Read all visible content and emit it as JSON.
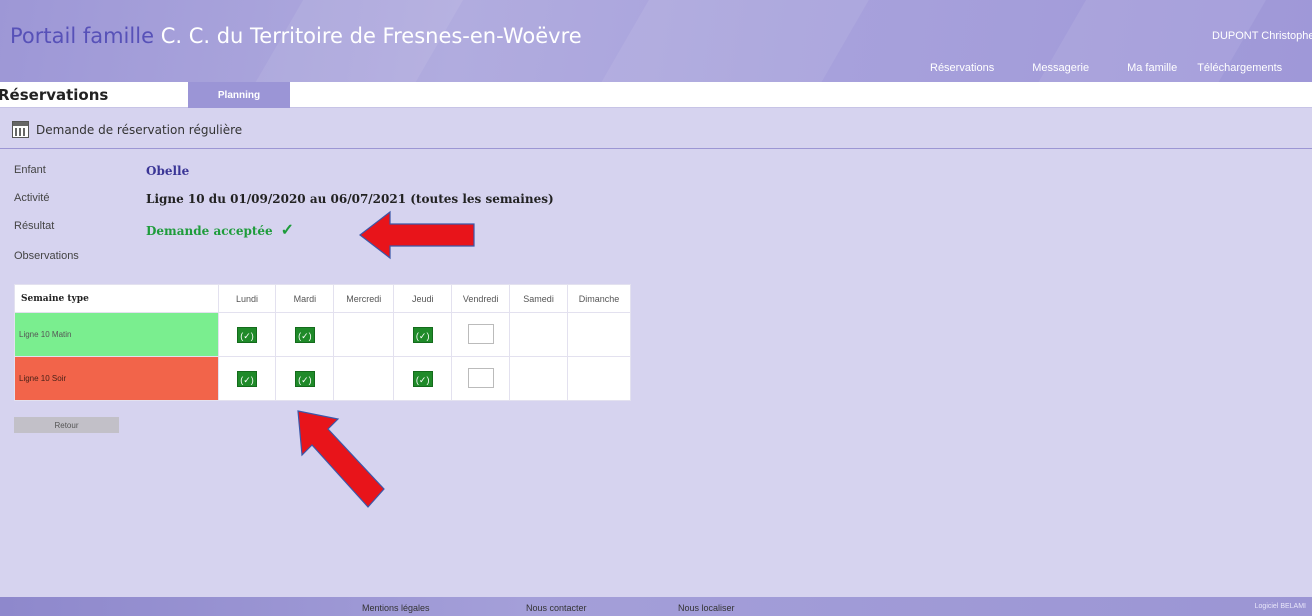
{
  "header": {
    "app_name": "Portail famille",
    "organization": "C. C. du Territoire de Fresnes-en-Woëvre",
    "user": "DUPONT Christophe",
    "nav": [
      "Réservations",
      "Messagerie",
      "Ma famille",
      "Téléchargements"
    ]
  },
  "tabs": {
    "title": "Réservations",
    "active_tab": "Planning"
  },
  "section": {
    "icon": "calendar-icon",
    "label": "Demande de réservation régulière"
  },
  "info": {
    "enfant_label": "Enfant",
    "enfant_value": "Obelle",
    "activite_label": "Activité",
    "activite_value": "Ligne 10 du 01/09/2020 au 06/07/2021 (toutes les semaines)",
    "resultat_label": "Résultat",
    "resultat_value": "Demande acceptée",
    "resultat_icon": "checkmark-icon",
    "observations_label": "Observations"
  },
  "planning": {
    "header": "Semaine type",
    "days": [
      "Lundi",
      "Mardi",
      "Mercredi",
      "Jeudi",
      "Vendredi",
      "Samedi",
      "Dimanche"
    ],
    "rows": [
      {
        "label": "Ligne 10 Matin",
        "color": "#7aee8f",
        "cells": [
          "checked",
          "checked",
          "none",
          "checked",
          "empty",
          "none",
          "none"
        ]
      },
      {
        "label": "Ligne 10 Soir",
        "color": "#f2644a",
        "cells": [
          "checked",
          "checked",
          "none",
          "checked",
          "empty",
          "none",
          "none"
        ]
      }
    ],
    "check_symbol": "(✓)"
  },
  "buttons": {
    "retour": "Retour"
  },
  "footer": {
    "mentions": "Mentions légales",
    "contact": "Nous contacter",
    "localiser": "Nous localiser",
    "copyright": "Logiciel BELAMI"
  },
  "colors": {
    "accent": "#9b95d6",
    "success": "#1e9c3b",
    "arrow": "#e8141a"
  }
}
